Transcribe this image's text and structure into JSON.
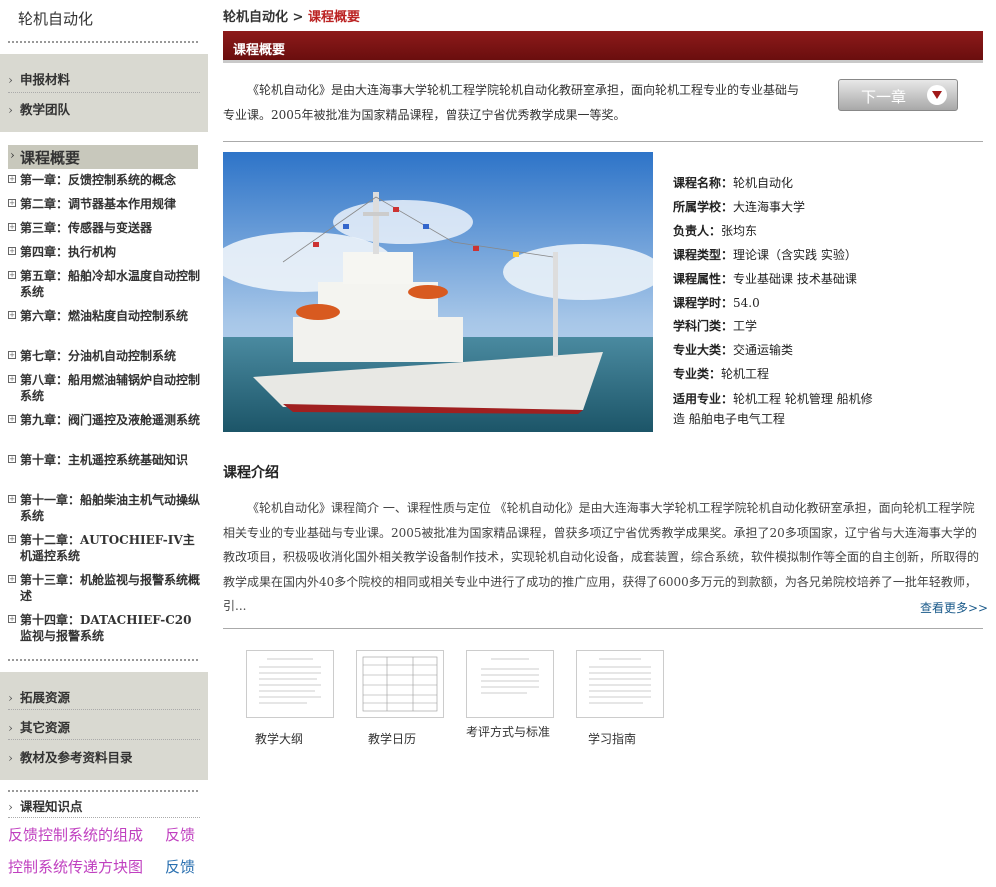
{
  "sidebar": {
    "title": "轮机自动化",
    "top_items": [
      "申报材料",
      "教学团队"
    ],
    "active": "课程概要",
    "chapters": [
      "第一章：反馈控制系统的概念",
      "第二章：调节器基本作用规律",
      "第三章：传感器与变送器",
      "第四章：执行机构",
      "第五章：船舶冷却水温度自动控制系统",
      "第六章：燃油粘度自动控制系统",
      "第七章：分油机自动控制系统",
      "第八章：船用燃油辅锅炉自动控制系统",
      "第九章：阀门遥控及液舱遥测系统",
      "第十章：主机遥控系统基础知识",
      "第十一章：船舶柴油主机气动操纵系统",
      "第十二章：AUTOCHIEF-IV主机遥控系统",
      "第十三章：机舱监视与报警系统概述",
      "第十四章：DATACHIEF-C20监视与报警系统"
    ],
    "resources": [
      "拓展资源",
      "其它资源",
      "教材及参考资料目录"
    ],
    "kp_title": "课程知识点",
    "kp": [
      "反馈控制系统的组成",
      "反馈",
      "控制系统传递方块图",
      "反馈"
    ]
  },
  "breadcrumb": {
    "root": "轮机自动化",
    "sep": " > ",
    "current": "课程概要"
  },
  "header": {
    "title": "课程概要"
  },
  "intro": "《轮机自动化》是由大连海事大学轮机工程学院轮机自动化教研室承担，面向轮机工程专业的专业基础与专业课。2005年被批准为国家精品课程，曾获辽宁省优秀教学成果一等奖。",
  "next_button": "下一章",
  "info": [
    {
      "label": "课程名称：",
      "value": "轮机自动化"
    },
    {
      "label": "所属学校：",
      "value": "大连海事大学"
    },
    {
      "label": "负责人：",
      "value": "张均东"
    },
    {
      "label": "课程类型：",
      "value": "理论课（含实践 实验）"
    },
    {
      "label": "课程属性：",
      "value": "专业基础课 技术基础课"
    },
    {
      "label": "课程学时：",
      "value": "54.0"
    },
    {
      "label": "学科门类：",
      "value": "工学"
    },
    {
      "label": "专业大类：",
      "value": "交通运输类"
    },
    {
      "label": "专业类：",
      "value": "轮机工程"
    },
    {
      "label": "适用专业：",
      "value": "轮机工程 轮机管理 船机修造 船舶电子电气工程"
    }
  ],
  "course_intro": {
    "title": "课程介绍",
    "body": "《轮机自动化》课程简介 一、课程性质与定位 《轮机自动化》是由大连海事大学轮机工程学院轮机自动化教研室承担，面向轮机工程学院相关专业的专业基础与专业课。2005被批准为国家精品课程，曾获多项辽宁省优秀教学成果奖。承担了20多项国家，辽宁省与大连海事大学的教改项目，积极吸收消化国外相关教学设备制作技术，实现轮机自动化设备，成套装置，综合系统，软件模拟制作等全面的自主创新，所取得的教学成果在国内外40多个院校的相同或相关专业中进行了成功的推广应用，获得了6000多万元的到款额，为各兄弟院校培养了一批年轻教师，引...",
    "more": "查看更多>>"
  },
  "docs": [
    "教学大纲",
    "教学日历",
    "考评方式与标准",
    "学习指南"
  ]
}
